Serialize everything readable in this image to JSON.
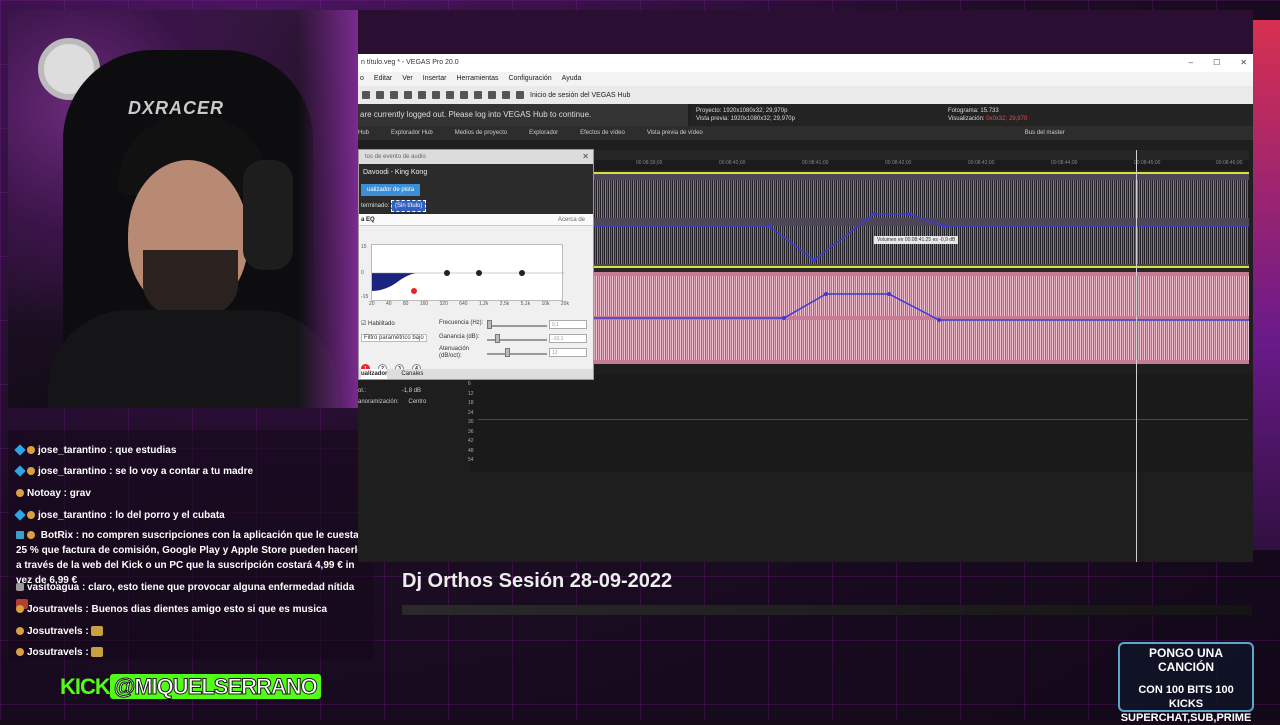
{
  "stream": {
    "kick_label": "KICK",
    "kick_handle": "@MIQUELSERRANO",
    "video_title": "Dj Orthos Sesión 28-09-2022",
    "promo": {
      "line1": "PONGO UNA CANCIÓN",
      "line2": "CON 100 BITS 100 KICKS",
      "line3": "SUPERCHAT,SUB,PRIME"
    },
    "webcam_chair_brand": "DXRACER"
  },
  "chat": {
    "messages": [
      {
        "user": "jose_tarantino",
        "text": "que estudias"
      },
      {
        "user": "jose_tarantino",
        "text": "se lo voy a contar a tu madre"
      },
      {
        "user": "Notoay",
        "text": "grav"
      },
      {
        "user": "jose_tarantino",
        "text": "lo del porro y el cubata"
      },
      {
        "user": "BotRix",
        "text": "no compren suscripciones con la aplicación que le cuesta 25 % que factura de comisión, Google Play y Apple Store pueden hacerlo a través de la web del Kick o un PC que la suscripción costará 4,99 € in vez de 6,99 €"
      },
      {
        "user": "vasitoagua",
        "text": "claro, esto tiene que provocar alguna enfermedad nítida"
      },
      {
        "user": "Josutravels",
        "text": "Buenos dias dientes amigo esto si que es musica"
      },
      {
        "user": "Josutravels",
        "text": ""
      },
      {
        "user": "Josutravels",
        "text": ""
      }
    ]
  },
  "vegas": {
    "window_title": "n título.veg * - VEGAS Pro 20.0",
    "menu": [
      "o",
      "Editar",
      "Ver",
      "Insertar",
      "Herramientas",
      "Configuración",
      "Ayuda"
    ],
    "hub_login": "Inicio de sesión del VEGAS Hub",
    "hub_message": "are currently logged out. Please log into VEGAS Hub to continue.",
    "tabs": [
      "Hub",
      "Explorador Hub",
      "Medios de proyecto",
      "Explorador",
      "Efectos de vídeo",
      "Vista previa de vídeo",
      "Bus del master"
    ],
    "preview": {
      "proyecto_label": "Proyecto:",
      "proyecto": "1920x1080x32; 29,970p",
      "vista_label": "Vista previa:",
      "vista": "1920x1080x32; 29,970p",
      "fotograma_label": "Fotograma:",
      "fotograma": "15.733",
      "visualizacion_label": "Visualización:",
      "visualizacion": "0x0x32; 29,970"
    },
    "ruler": [
      "00:08:39;00",
      "00:08:40;00",
      "00:08:41;00",
      "00:08:42;00",
      "00:08:43;00",
      "00:08:44;00",
      "00:08:45;00",
      "00:08:46;00"
    ],
    "tooltip": "Volumen en 00:08:41;25 es -0,9 dB",
    "mixer": {
      "vol_label": "ol.:",
      "vol_value": "-1,8 dB",
      "pan_label": "anoramización:",
      "pan_value": "Centro"
    },
    "db_scale": [
      "6",
      "12",
      "18",
      "24",
      "30",
      "36",
      "42",
      "48",
      "54"
    ]
  },
  "fx": {
    "header": "tos de evento de audio",
    "track": "Davoodi - King Kong",
    "plugin_pill": "ualizador de pista",
    "preset_label": "terminado:",
    "preset_value": "(Sin título)",
    "eq_title": "a EQ",
    "about": "Acerca de",
    "eq_freqs": [
      "20",
      "40",
      "80",
      "160",
      "320",
      "640",
      "1,2k",
      "2,5k",
      "5,1k",
      "10k",
      "20k"
    ],
    "y_top": "15",
    "y_zero": "0",
    "y_bottom": "-15",
    "enabled": "Habilitado",
    "filter_type": "Filtro paramétrico bajo",
    "freq_label": "Frecuencia (Hz):",
    "freq_value": "9,1",
    "gain_label": "Ganancia (dB):",
    "gain_value": "-10,1",
    "atten_label": "Atenuación (dB/oct):",
    "atten_value": "12",
    "bands": [
      "1",
      "2",
      "3",
      "4"
    ],
    "footer_tabs": [
      "ualizador",
      "Canales"
    ]
  }
}
